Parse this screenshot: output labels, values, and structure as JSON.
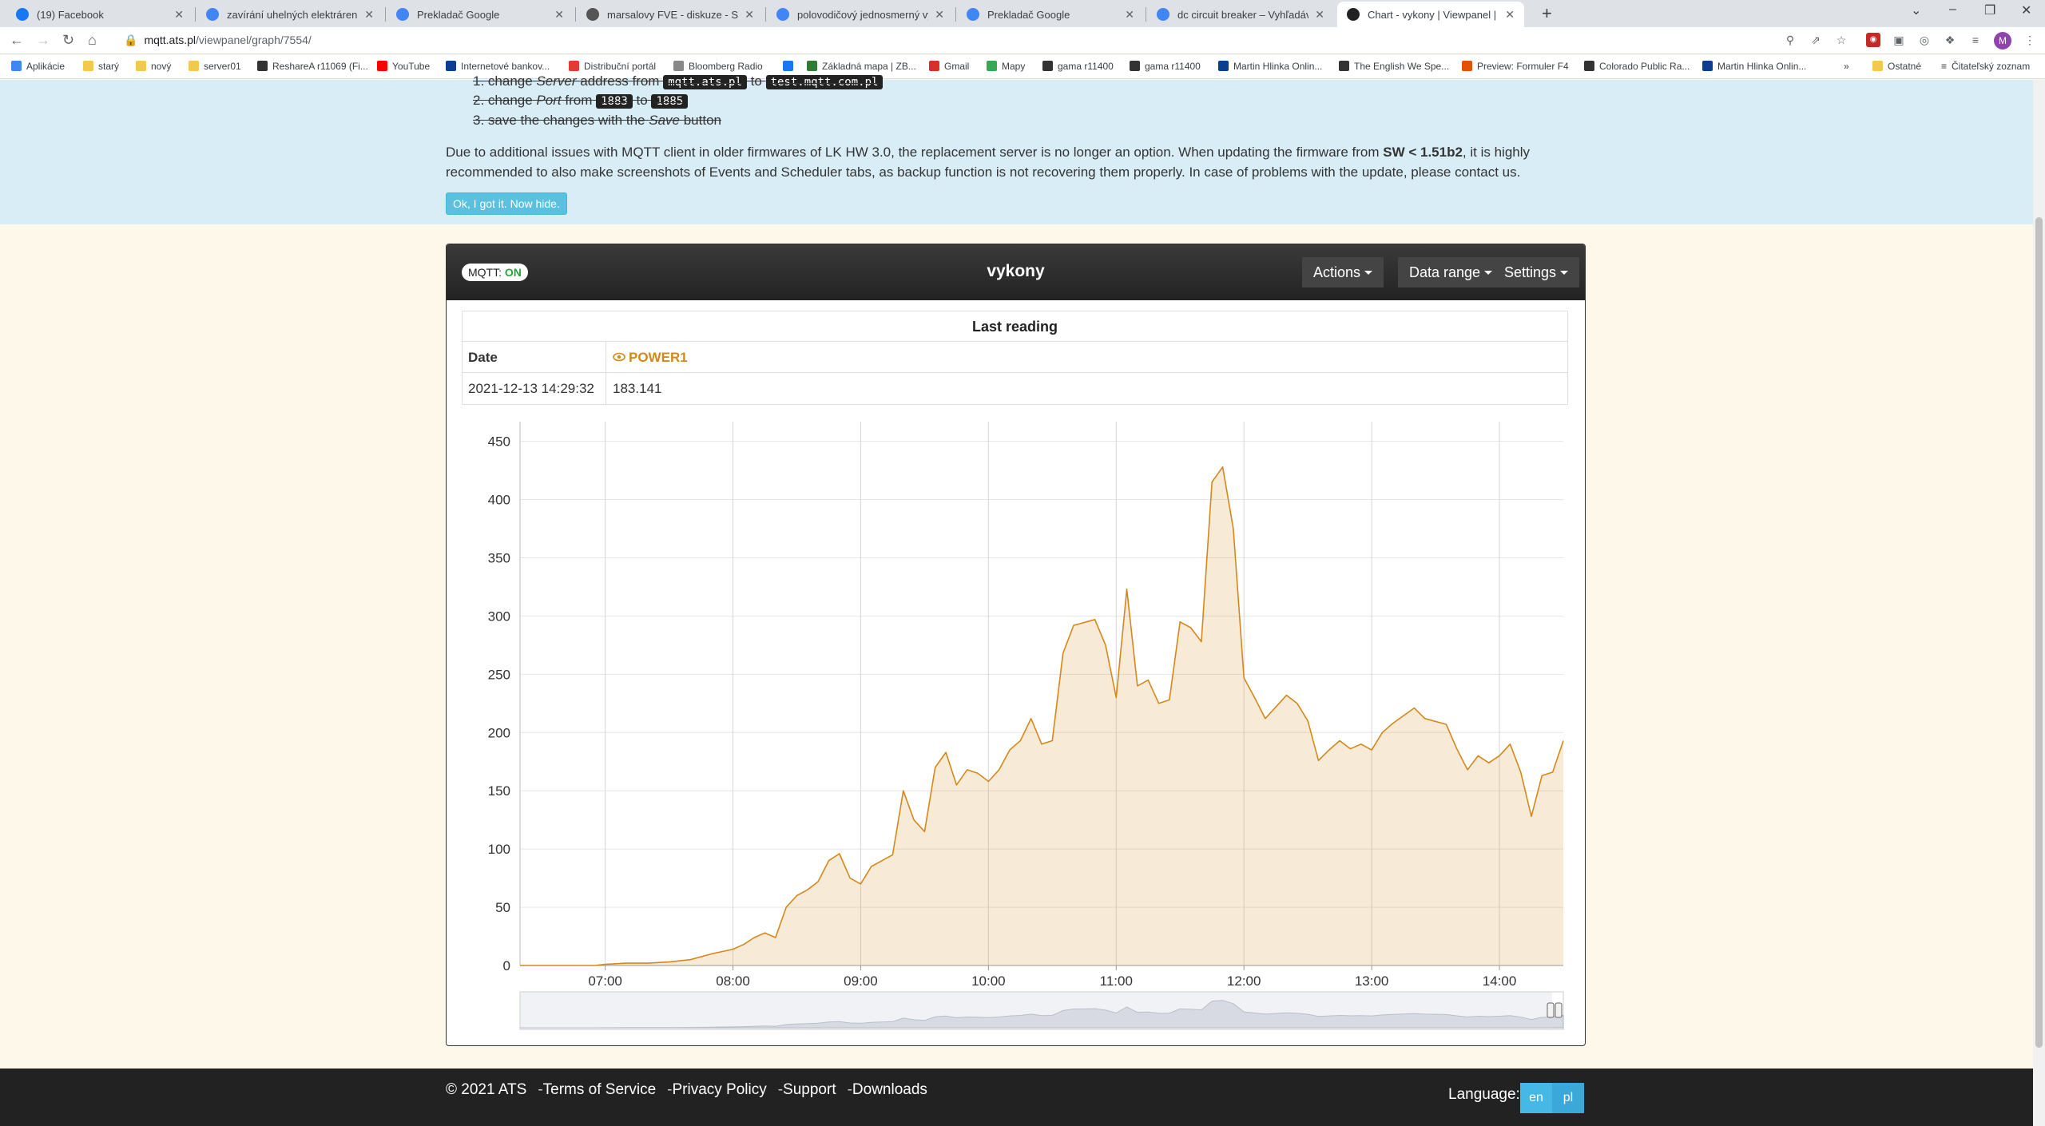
{
  "browser": {
    "tabs": [
      {
        "title": "(19) Facebook",
        "favicon_color": "#1877f2",
        "active": false
      },
      {
        "title": "zavírání uhelných elektráren v EU",
        "favicon_color": "#4285f4",
        "active": false
      },
      {
        "title": "Prekladač Google",
        "favicon_color": "#4285f4",
        "active": false
      },
      {
        "title": "marsalovy FVE - diskuze - Strana",
        "favicon_color": "#555555",
        "active": false
      },
      {
        "title": "polovodičový jednosmerný vypín",
        "favicon_color": "#4285f4",
        "active": false
      },
      {
        "title": "Prekladač Google",
        "favicon_color": "#4285f4",
        "active": false
      },
      {
        "title": "dc circuit breaker – Vyhľadávanie",
        "favicon_color": "#4285f4",
        "active": false
      },
      {
        "title": "Chart - vykony | Viewpanel | MQ",
        "favicon_color": "#222222",
        "active": true
      }
    ],
    "url_host": "mqtt.ats.pl",
    "url_path": "/viewpanel/graph/7554/",
    "avatar_letter": "M",
    "bookmarks": [
      {
        "label": "Aplikácie",
        "color": "#4285f4"
      },
      {
        "label": "starý",
        "color": "#f2c94c"
      },
      {
        "label": "nový",
        "color": "#f2c94c"
      },
      {
        "label": "server01",
        "color": "#f2c94c"
      },
      {
        "label": "ReshareA r11069 (Fi...",
        "color": "#333333"
      },
      {
        "label": "YouTube",
        "color": "#ff0000"
      },
      {
        "label": "Internetové bankov...",
        "color": "#0b3d91"
      },
      {
        "label": "Distribuční portál",
        "color": "#e53935"
      },
      {
        "label": "Bloomberg Radio",
        "color": "#888888"
      },
      {
        "label": "",
        "color": "#1877f2"
      },
      {
        "label": "Základná mapa | ZB...",
        "color": "#2e7d32"
      },
      {
        "label": "Gmail",
        "color": "#d93025"
      },
      {
        "label": "Mapy",
        "color": "#34a853"
      },
      {
        "label": "gama r11400",
        "color": "#333333"
      },
      {
        "label": "gama r11400",
        "color": "#333333"
      },
      {
        "label": "Martin Hlinka Onlin...",
        "color": "#0b3d91"
      },
      {
        "label": "The English We Spe...",
        "color": "#333333"
      },
      {
        "label": "Preview: Formuler F4",
        "color": "#e65100"
      },
      {
        "label": "Colorado Public Ra...",
        "color": "#333333"
      },
      {
        "label": "Martin Hlinka Onlin...",
        "color": "#0b3d91"
      }
    ],
    "bookmarks_more": "»",
    "other_bookmarks": "Ostatné",
    "reading_list": "Čitateľský zoznam"
  },
  "notice": {
    "step1_num": "1.",
    "step1_a": "change",
    "step1_b": "Server",
    "step1_c": "address from",
    "step1_code1": "mqtt.ats.pl",
    "step1_d": "to",
    "step1_code2": "test.mqtt.com.pl",
    "step2_num": "2.",
    "step2_a": "change",
    "step2_b": "Port",
    "step2_c": "from",
    "step2_code1": "1883",
    "step2_d": "to",
    "step2_code2": "1885",
    "step3_num": "3.",
    "step3_a": "save the changes with the",
    "step3_b": "Save",
    "step3_c": "button",
    "text_a": "Due to additional issues with MQTT client in older firmwares of LK HW 3.0, the replacement server is no longer an option. When updating the firmware from",
    "text_bold": "SW < 1.51b2",
    "text_b": ", it is highly recommended to also make screenshots of Events and Scheduler tabs, as backup function is not recovering them properly. In case of problems with the update, please contact us.",
    "button": "Ok, I got it. Now hide."
  },
  "panel": {
    "mqtt_label": "MQTT:",
    "mqtt_state": "ON",
    "title": "vykony",
    "menu_actions": "Actions",
    "menu_range": "Data range",
    "menu_settings": "Settings",
    "last_reading_title": "Last reading",
    "col_date": "Date",
    "col_series": "POWER1",
    "reading_date": "2021-12-13 14:29:32",
    "reading_value": "183.141"
  },
  "chart_data": {
    "type": "area",
    "series": [
      {
        "name": "POWER1",
        "color": "#d4881a"
      }
    ],
    "x_ticks": [
      "07:00",
      "08:00",
      "09:00",
      "10:00",
      "11:00",
      "12:00",
      "13:00",
      "14:00"
    ],
    "x_range": [
      "06:20",
      "14:30"
    ],
    "y_ticks": [
      0,
      50,
      100,
      150,
      200,
      250,
      300,
      350,
      400,
      450
    ],
    "ylim": [
      0,
      460
    ],
    "grid": true,
    "legend": "none",
    "navigator": true,
    "points": [
      [
        "06:20",
        0
      ],
      [
        "06:40",
        0
      ],
      [
        "06:55",
        0
      ],
      [
        "07:00",
        1
      ],
      [
        "07:10",
        2
      ],
      [
        "07:20",
        2
      ],
      [
        "07:30",
        3
      ],
      [
        "07:40",
        5
      ],
      [
        "07:50",
        10
      ],
      [
        "08:00",
        14
      ],
      [
        "08:05",
        18
      ],
      [
        "08:10",
        24
      ],
      [
        "08:15",
        28
      ],
      [
        "08:20",
        24
      ],
      [
        "08:25",
        50
      ],
      [
        "08:30",
        60
      ],
      [
        "08:35",
        65
      ],
      [
        "08:40",
        72
      ],
      [
        "08:45",
        90
      ],
      [
        "08:50",
        96
      ],
      [
        "08:55",
        75
      ],
      [
        "09:00",
        70
      ],
      [
        "09:05",
        85
      ],
      [
        "09:10",
        90
      ],
      [
        "09:15",
        95
      ],
      [
        "09:20",
        150
      ],
      [
        "09:25",
        125
      ],
      [
        "09:30",
        115
      ],
      [
        "09:35",
        170
      ],
      [
        "09:40",
        183
      ],
      [
        "09:45",
        155
      ],
      [
        "09:50",
        168
      ],
      [
        "09:55",
        165
      ],
      [
        "10:00",
        158
      ],
      [
        "10:05",
        168
      ],
      [
        "10:10",
        185
      ],
      [
        "10:15",
        193
      ],
      [
        "10:20",
        212
      ],
      [
        "10:25",
        190
      ],
      [
        "10:30",
        193
      ],
      [
        "10:35",
        268
      ],
      [
        "10:40",
        292
      ],
      [
        "10:50",
        297
      ],
      [
        "10:55",
        275
      ],
      [
        "11:00",
        230
      ],
      [
        "11:05",
        323
      ],
      [
        "11:10",
        240
      ],
      [
        "11:15",
        245
      ],
      [
        "11:20",
        225
      ],
      [
        "11:25",
        228
      ],
      [
        "11:30",
        295
      ],
      [
        "11:35",
        290
      ],
      [
        "11:40",
        278
      ],
      [
        "11:45",
        415
      ],
      [
        "11:50",
        428
      ],
      [
        "11:55",
        375
      ],
      [
        "12:00",
        247
      ],
      [
        "12:05",
        230
      ],
      [
        "12:10",
        212
      ],
      [
        "12:20",
        232
      ],
      [
        "12:25",
        225
      ],
      [
        "12:30",
        210
      ],
      [
        "12:35",
        176
      ],
      [
        "12:40",
        185
      ],
      [
        "12:45",
        193
      ],
      [
        "12:50",
        186
      ],
      [
        "12:55",
        190
      ],
      [
        "13:00",
        185
      ],
      [
        "13:05",
        200
      ],
      [
        "13:10",
        208
      ],
      [
        "13:20",
        221
      ],
      [
        "13:25",
        212
      ],
      [
        "13:35",
        207
      ],
      [
        "13:40",
        186
      ],
      [
        "13:45",
        168
      ],
      [
        "13:50",
        180
      ],
      [
        "13:55",
        174
      ],
      [
        "14:00",
        180
      ],
      [
        "14:05",
        190
      ],
      [
        "14:10",
        166
      ],
      [
        "14:15",
        128
      ],
      [
        "14:20",
        163
      ],
      [
        "14:25",
        166
      ],
      [
        "14:30",
        193
      ]
    ]
  },
  "footer": {
    "copyright": "© 2021 ATS",
    "sep": "-",
    "terms": "Terms of Service",
    "privacy": "Privacy Policy",
    "support": "Support",
    "downloads": "Downloads",
    "language_label": "Language:",
    "lang_en": "en",
    "lang_pl": "pl"
  }
}
